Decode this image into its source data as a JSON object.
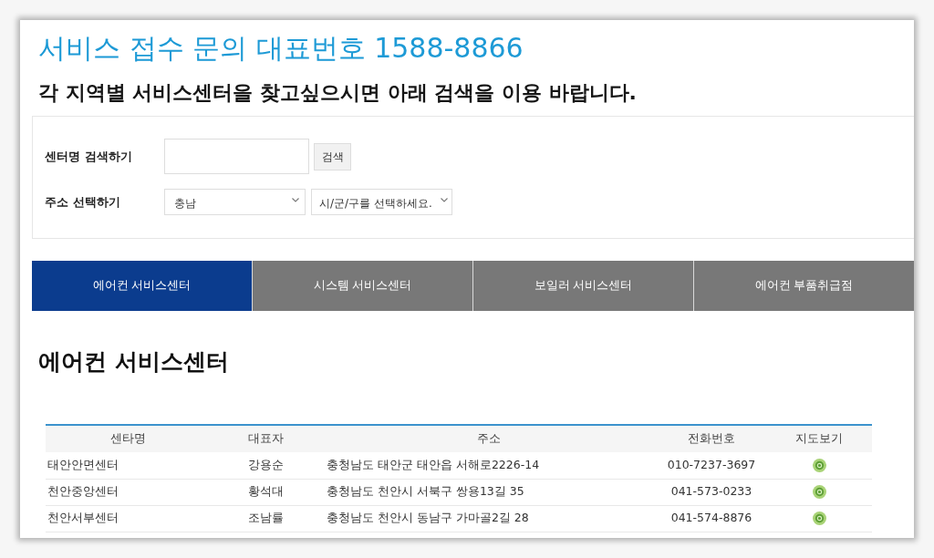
{
  "hotline_title": "서비스 접수 문의 대표번호 1588-8866",
  "intro": "각 지역별 서비스센터을 찾고싶으시면 아래 검색을 이용 바랍니다.",
  "search_form": {
    "name_search": {
      "label": "센터명 검색하기",
      "button": "검색"
    },
    "address_select": {
      "label": "주소 선택하기",
      "province": "충남",
      "district": "시/군/구를 선택하세요."
    }
  },
  "tabs": [
    {
      "label": "에어컨 서비스센터",
      "selected": true
    },
    {
      "label": "시스템 서비스센터",
      "selected": false
    },
    {
      "label": "보일러 서비스센터",
      "selected": false
    },
    {
      "label": "에어컨 부품취급점",
      "selected": false
    }
  ],
  "section_title": "에어컨 서비스센터",
  "table": {
    "columns": [
      "센타명",
      "대표자",
      "주소",
      "전화번호",
      "지도보기"
    ],
    "rows": [
      {
        "center_name": "태안안면센터",
        "representative": "강용순",
        "address": "충청남도 태안군 태안읍 서해로2226-14",
        "phone": "010-7237-3697"
      },
      {
        "center_name": "천안중앙센터",
        "representative": "황석대",
        "address": "충청남도 천안시 서북구 쌍용13길 35",
        "phone": "041-573-0233"
      },
      {
        "center_name": "천안서부센터",
        "representative": "조남률",
        "address": "충청남도 천안시 동남구 가마골2길 28",
        "phone": "041-574-8876"
      }
    ]
  }
}
